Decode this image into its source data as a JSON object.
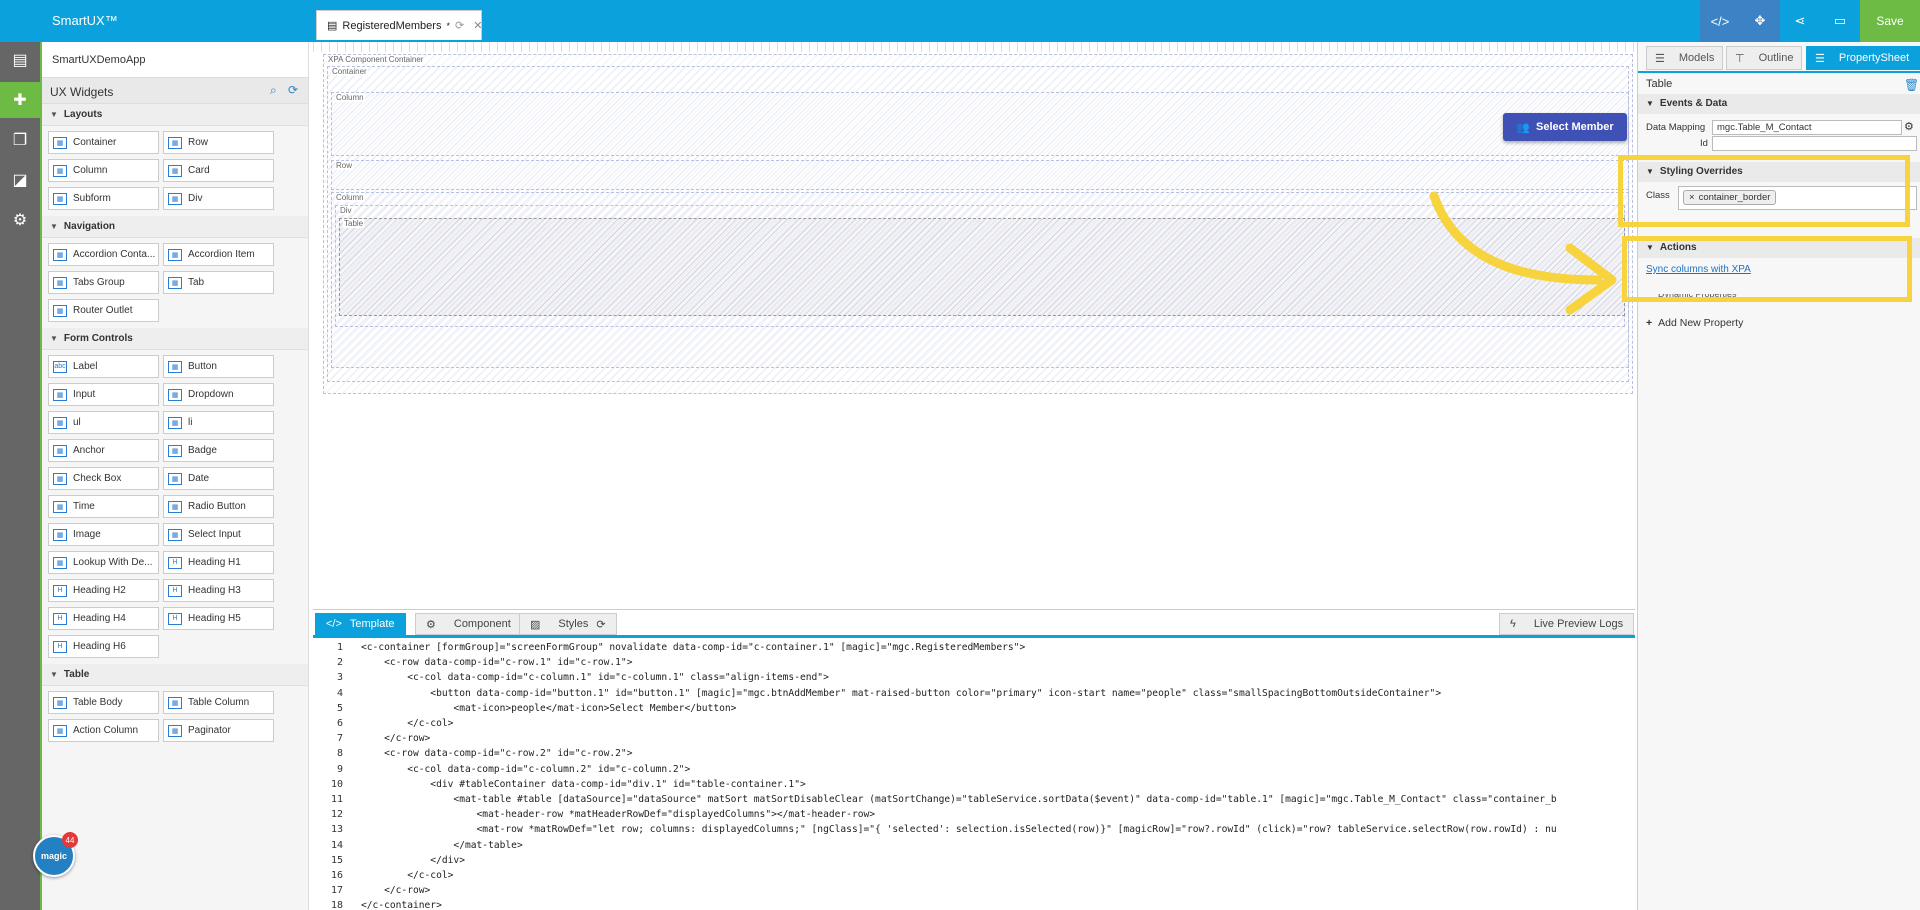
{
  "app": {
    "brand": "SmartUX™",
    "doc_tab": "RegisteredMembers",
    "doc_tab_dirty": "*",
    "save_label": "Save",
    "app_name": "SmartUXDemoApp",
    "badge_label": "magic",
    "badge_count": "44"
  },
  "widgets": {
    "title": "UX Widgets",
    "layouts": {
      "label": "Layouts",
      "items": [
        "Container",
        "Row",
        "Column",
        "Card",
        "Subform",
        "Div"
      ]
    },
    "navigation": {
      "label": "Navigation",
      "items": [
        "Accordion Conta...",
        "Accordion Item",
        "Tabs Group",
        "Tab",
        "Router Outlet"
      ]
    },
    "form_controls": {
      "label": "Form Controls",
      "items": [
        "Label",
        "Button",
        "Input",
        "Dropdown",
        "ul",
        "li",
        "Anchor",
        "Badge",
        "Check Box",
        "Date",
        "Time",
        "Radio Button",
        "Image",
        "Select Input",
        "Lookup With De...",
        "Heading H1",
        "Heading H2",
        "Heading H3",
        "Heading H4",
        "Heading H5",
        "Heading H6"
      ]
    },
    "table": {
      "label": "Table",
      "items": [
        "Table Body",
        "Table Column",
        "Action Column",
        "Paginator"
      ]
    }
  },
  "canvas": {
    "labels": {
      "xpa": "XPA Component Container",
      "container": "Container",
      "column": "Column",
      "row": "Row",
      "column2": "Column",
      "div": "Div",
      "table": "Table"
    },
    "select_button": "Select Member"
  },
  "bottom_tabs": {
    "template": "Template",
    "component": "Component",
    "styles": "Styles",
    "live": "Live Preview Logs"
  },
  "code_lines": [
    {
      "n": "1",
      "t": "<c-container [formGroup]=\"screenFormGroup\" novalidate data-comp-id=\"c-container.1\" [magic]=\"mgc.RegisteredMembers\">"
    },
    {
      "n": "2",
      "t": "    <c-row data-comp-id=\"c-row.1\" id=\"c-row.1\">"
    },
    {
      "n": "3",
      "t": "        <c-col data-comp-id=\"c-column.1\" id=\"c-column.1\" class=\"align-items-end\">"
    },
    {
      "n": "4",
      "t": "            <button data-comp-id=\"button.1\" id=\"button.1\" [magic]=\"mgc.btnAddMember\" mat-raised-button color=\"primary\" icon-start name=\"people\" class=\"smallSpacingBottomOutsideContainer\">"
    },
    {
      "n": "5",
      "t": "                <mat-icon>people</mat-icon>Select Member</button>"
    },
    {
      "n": "6",
      "t": "        </c-col>"
    },
    {
      "n": "7",
      "t": "    </c-row>"
    },
    {
      "n": "8",
      "t": "    <c-row data-comp-id=\"c-row.2\" id=\"c-row.2\">"
    },
    {
      "n": "9",
      "t": "        <c-col data-comp-id=\"c-column.2\" id=\"c-column.2\">"
    },
    {
      "n": "10",
      "t": "            <div #tableContainer data-comp-id=\"div.1\" id=\"table-container.1\">"
    },
    {
      "n": "11",
      "t": "                <mat-table #table [dataSource]=\"dataSource\" matSort matSortDisableClear (matSortChange)=\"tableService.sortData($event)\" data-comp-id=\"table.1\" [magic]=\"mgc.Table_M_Contact\" class=\"container_b"
    },
    {
      "n": "12",
      "t": "                    <mat-header-row *matHeaderRowDef=\"displayedColumns\"></mat-header-row>"
    },
    {
      "n": "13",
      "t": "                    <mat-row *matRowDef=\"let row; columns: displayedColumns;\" [ngClass]=\"{ 'selected': selection.isSelected(row)}\" [magicRow]=\"row?.rowId\" (click)=\"row? tableService.selectRow(row.rowId) : nu"
    },
    {
      "n": "14",
      "t": "                </mat-table>"
    },
    {
      "n": "15",
      "t": "            </div>"
    },
    {
      "n": "16",
      "t": "        </c-col>"
    },
    {
      "n": "17",
      "t": "    </c-row>"
    },
    {
      "n": "18",
      "t": "</c-container>"
    }
  ],
  "right_panel": {
    "tabs": {
      "models": "Models",
      "outline": "Outline",
      "property": "PropertySheet"
    },
    "title": "Table",
    "events_section": "Events & Data",
    "data_mapping_label": "Data Mapping",
    "data_mapping_value": "mgc.Table_M_Contact",
    "id_label": "Id",
    "styling_section": "Styling Overrides",
    "class_label": "Class",
    "class_chip": "container_border",
    "actions_section": "Actions",
    "sync_link": "Sync columns with XPA",
    "dynamic_props": "Dynamic Properties",
    "add_property": "Add New Property"
  },
  "colors": {
    "accent": "#0aa1dc",
    "green": "#6dbb45",
    "highlight": "#f7d33e",
    "primary_button": "#3f51b5"
  }
}
